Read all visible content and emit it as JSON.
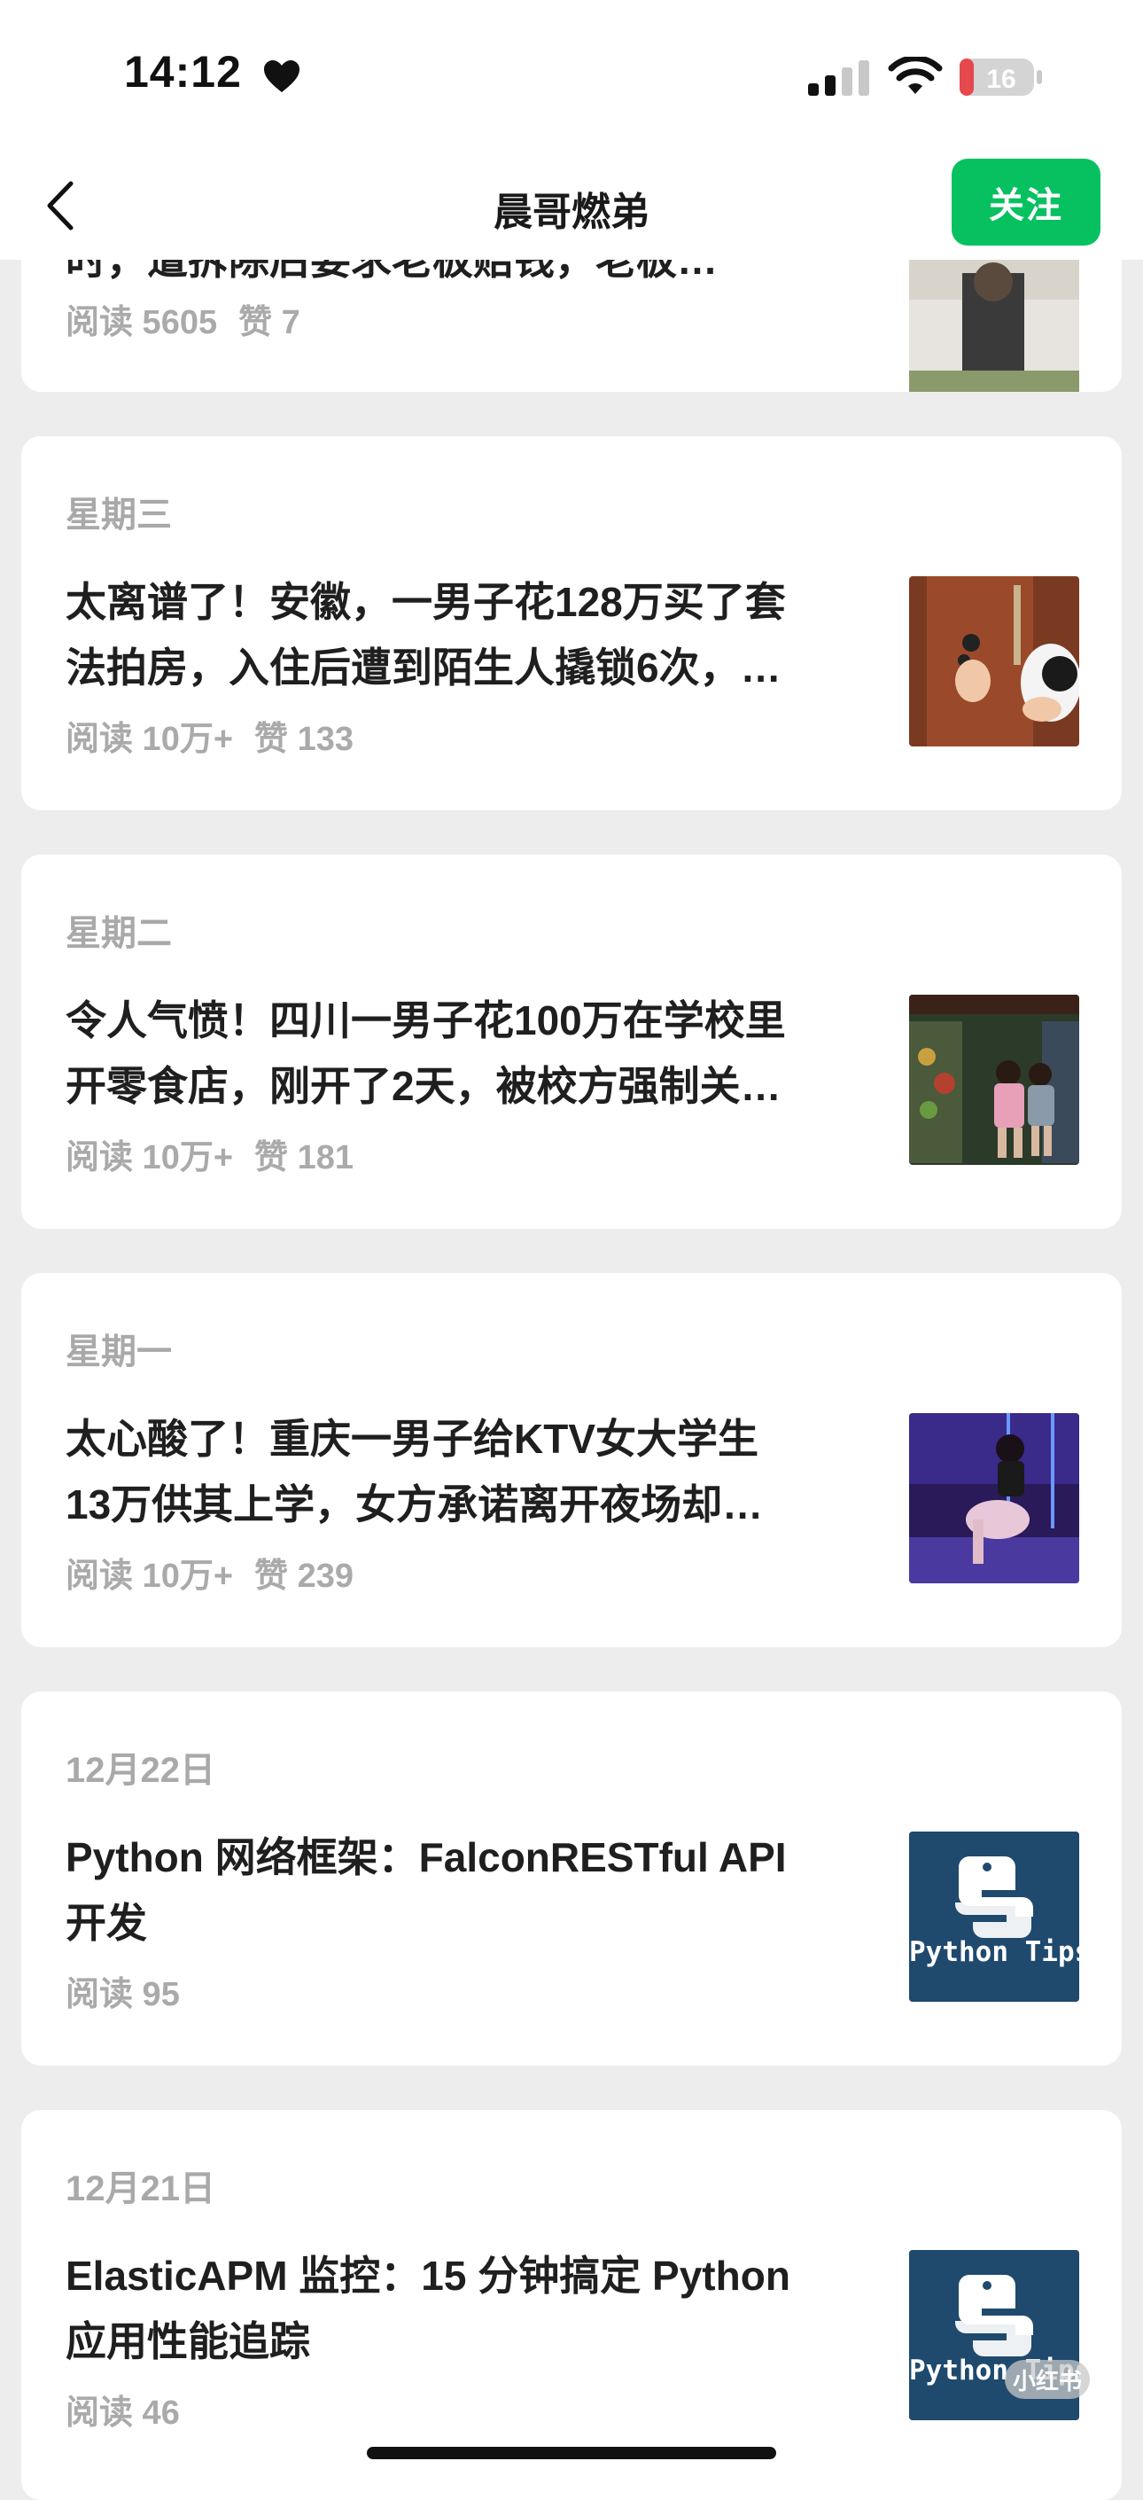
{
  "status_bar": {
    "time": "14:12",
    "battery": "16",
    "battery_color": "#e5484d"
  },
  "nav": {
    "title": "晨哥燃弟",
    "follow_label": "关注",
    "accent": "#07c160"
  },
  "articles": [
    {
      "date": "",
      "title_line1": "",
      "title_line2": "时，遭拆除后要求老板赔钱，老板…",
      "reads": "阅读 5605",
      "likes": "赞 7",
      "thumb": "street-photo"
    },
    {
      "date": "星期三",
      "title_line1": "太离谱了！安徽，一男子花128万买了套",
      "title_line2": "法拍房，入住后遭到陌生人撬锁6次，…",
      "reads": "阅读 10万+",
      "likes": "赞 133",
      "thumb": "door-lock-photo"
    },
    {
      "date": "星期二",
      "title_line1": "令人气愤！四川一男子花100万在学校里",
      "title_line2": "开零食店，刚开了2天，被校方强制关…",
      "reads": "阅读 10万+",
      "likes": "赞 181",
      "thumb": "snack-shop-photo"
    },
    {
      "date": "星期一",
      "title_line1": "太心酸了！重庆一男子给KTV女大学生",
      "title_line2": "13万供其上学，女方承诺离开夜场却…",
      "reads": "阅读 10万+",
      "likes": "赞 239",
      "thumb": "ktv-photo"
    },
    {
      "date": "12月22日",
      "title_line1": "Python 网络框架：FalconRESTful API",
      "title_line2": "开发",
      "reads": "阅读 95",
      "likes": "",
      "thumb": "python-tips",
      "thumb_text": "Python Tips"
    },
    {
      "date": "12月21日",
      "title_line1": "ElasticAPM 监控：15 分钟搞定 Python",
      "title_line2": "应用性能追踪",
      "reads": "阅读 46",
      "likes": "",
      "thumb": "python-tips",
      "thumb_text": "Python Tips"
    }
  ],
  "watermark": "小红书"
}
